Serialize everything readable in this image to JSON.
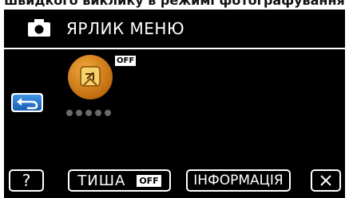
{
  "caption": "швидкого виклику в режимі фотографування",
  "header": {
    "mode_icon": "camera-icon",
    "title": "ЯРЛИК МЕНЮ"
  },
  "shortcut_item": {
    "icon": "shortcut-menu-icon",
    "state": "OFF",
    "page_indicator_dots": 5
  },
  "back_button": {
    "icon": "back-arrow-icon"
  },
  "footer": {
    "help_label": "?",
    "silent_label": "ТИША",
    "silent_state": "OFF",
    "info_label": "ІНФОРМАЦІЯ",
    "close_icon": "close-icon"
  },
  "colors": {
    "background": "#000000",
    "text": "#ffffff",
    "icon_orange": "#d07a12",
    "back_blue": "#2f7fd6"
  }
}
